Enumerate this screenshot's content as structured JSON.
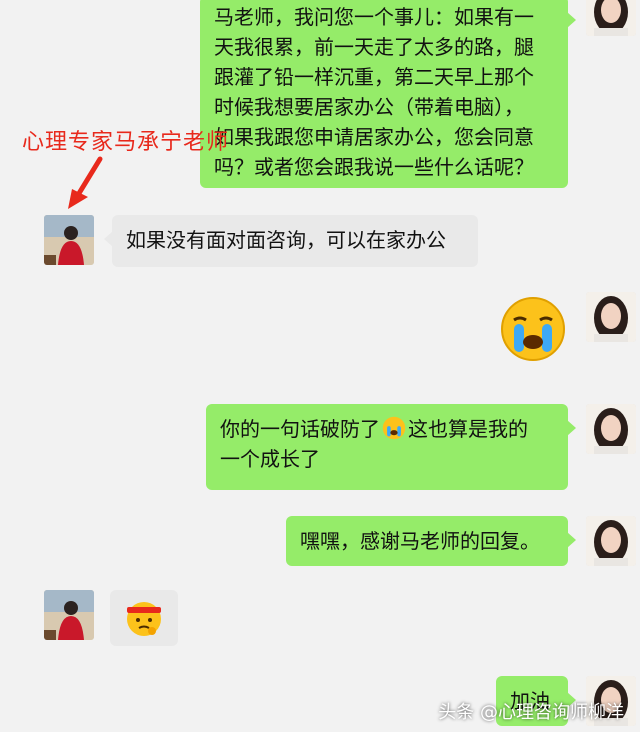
{
  "annotation": {
    "label": "心理专家马承宁老师"
  },
  "messages": {
    "m1": {
      "line1": "马老师，我问您一个事儿：如果有一",
      "line2": "天我很累，前一天走了太多的路，腿",
      "line3": "跟灌了铅一样沉重，第二天早上那个",
      "line4": "时候我想要居家办公（带着电脑），",
      "line5": "如果我跟您申请居家办公，您会同意",
      "line6": "吗？或者您会跟我说一些什么话呢？"
    },
    "m2": "如果没有面对面咨询，可以在家办公",
    "m4": {
      "part1": "你的一句话破防了",
      "part2": "这也算是我的",
      "line2": "一个成长了"
    },
    "m5": "嘿嘿，感谢马老师的回复。",
    "m7": "加油"
  },
  "icons": {
    "m3": "crying-emoji-icon",
    "m4_inline": "crying-emoji-icon",
    "m6": "thinking-headband-emoji-icon"
  },
  "watermark": "头条 @心理咨询师柳洋",
  "colors": {
    "sent_bubble": "#95ec69",
    "received_bubble": "#e9e9e9",
    "annotation": "#e8291c",
    "background": "#f2f2f2"
  }
}
